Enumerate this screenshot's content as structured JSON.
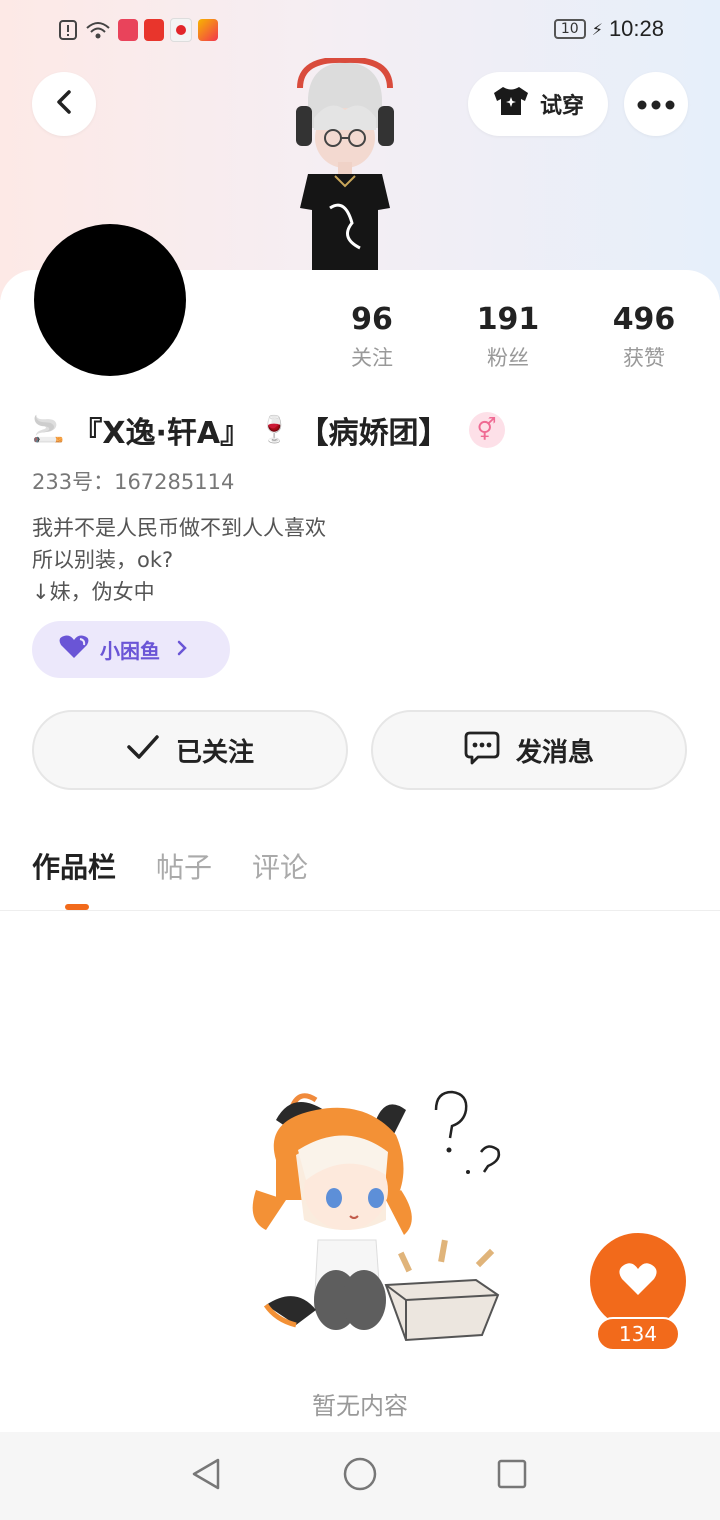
{
  "status_bar": {
    "battery": "10",
    "time": "10:28",
    "app_icons": [
      "alert-icon",
      "wifi-icon",
      "app-icon-1",
      "app-icon-2",
      "app-icon-3",
      "app-icon-4"
    ]
  },
  "header": {
    "try_on_label": "试穿"
  },
  "stats": [
    {
      "value": "96",
      "label": "关注"
    },
    {
      "value": "191",
      "label": "粉丝"
    },
    {
      "value": "496",
      "label": "获赞"
    }
  ],
  "profile": {
    "name_prefix_emoji": "🚬",
    "name": "『X逸·轩A』",
    "name_emoji": "🍷",
    "group": "【病娇团】",
    "gender_symbol": "⚥",
    "uid": "233号：167285114",
    "bio_lines": [
      "我并不是人民币做不到人人喜欢",
      "所以别装，ok?",
      "↓妹，伪女中"
    ],
    "club_label": "小困鱼"
  },
  "actions": {
    "follow_label": "已关注",
    "message_label": "发消息"
  },
  "tabs": [
    {
      "label": "作品栏",
      "active": true
    },
    {
      "label": "帖子",
      "active": false
    },
    {
      "label": "评论",
      "active": false
    }
  ],
  "empty_state": {
    "text": "暂无内容"
  },
  "like_button": {
    "count": "134"
  },
  "colors": {
    "accent": "#f26a1b",
    "club_purple": "#6a55d6"
  }
}
